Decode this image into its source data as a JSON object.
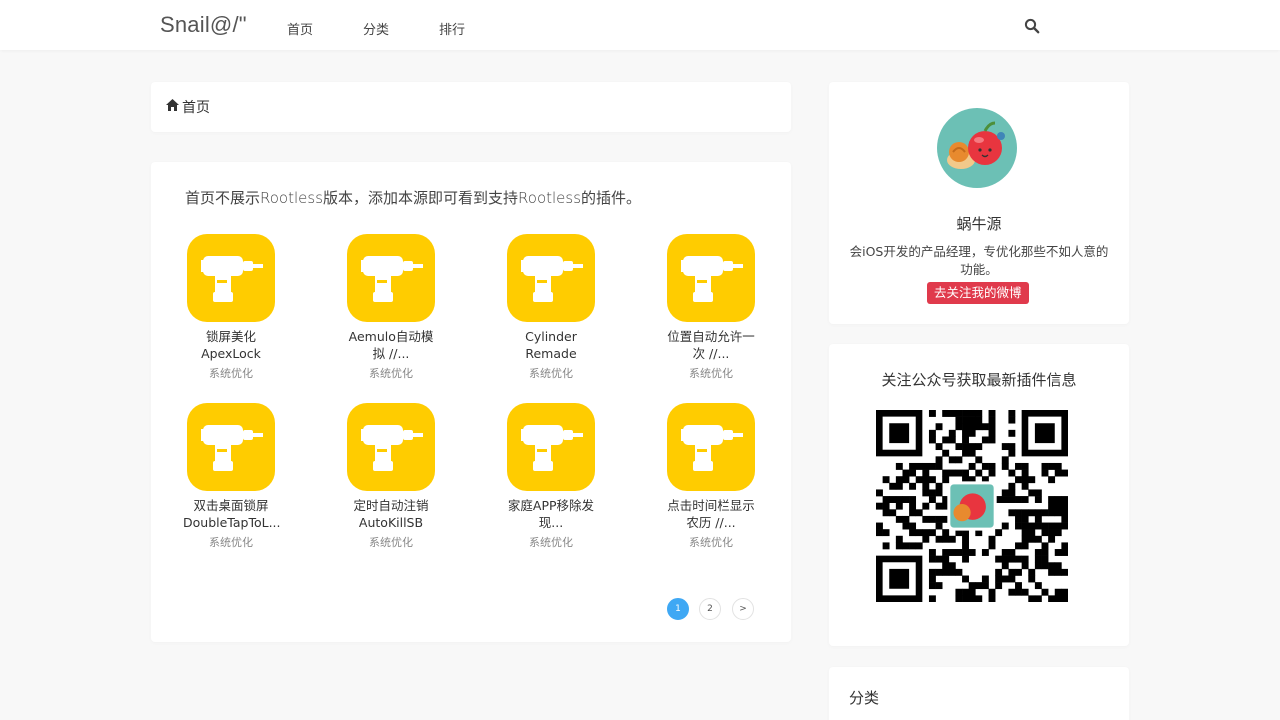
{
  "nav": {
    "brand": "Snail@/\"",
    "links": [
      "首页",
      "分类",
      "排行"
    ],
    "search_icon": "search-icon"
  },
  "breadcrumb": {
    "icon": "home-icon",
    "label": "首页"
  },
  "notice": "首页不展示Rootless版本，添加本源即可看到支持Rootless的插件。",
  "plugins": [
    {
      "name": "锁屏美化 ApexLock",
      "category": "系统优化"
    },
    {
      "name": "Aemulo自动模拟 //...",
      "category": "系统优化"
    },
    {
      "name": "Cylinder Remade",
      "category": "系统优化"
    },
    {
      "name": "位置自动允许一次 //...",
      "category": "系统优化"
    },
    {
      "name": "双击桌面锁屏 DoubleTapToL...",
      "category": "系统优化"
    },
    {
      "name": "定时自动注销 AutoKillSB",
      "category": "系统优化"
    },
    {
      "name": "家庭APP移除发现...",
      "category": "系统优化"
    },
    {
      "name": "点击时间栏显示农历 //...",
      "category": "系统优化"
    }
  ],
  "pagination": {
    "pages": [
      "1",
      "2"
    ],
    "current": "1",
    "next": ">"
  },
  "profile": {
    "name": "蜗牛源",
    "bio": "会iOS开发的产品经理，专优化那些不如人意的功能。",
    "button": "去关注我的微博"
  },
  "qr": {
    "title": "关注公众号获取最新插件信息"
  },
  "categories": {
    "title": "分类"
  },
  "colors": {
    "accent": "#3fa8f4",
    "icon_bg": "#ffcc00",
    "weibo": "#e03a4c"
  }
}
